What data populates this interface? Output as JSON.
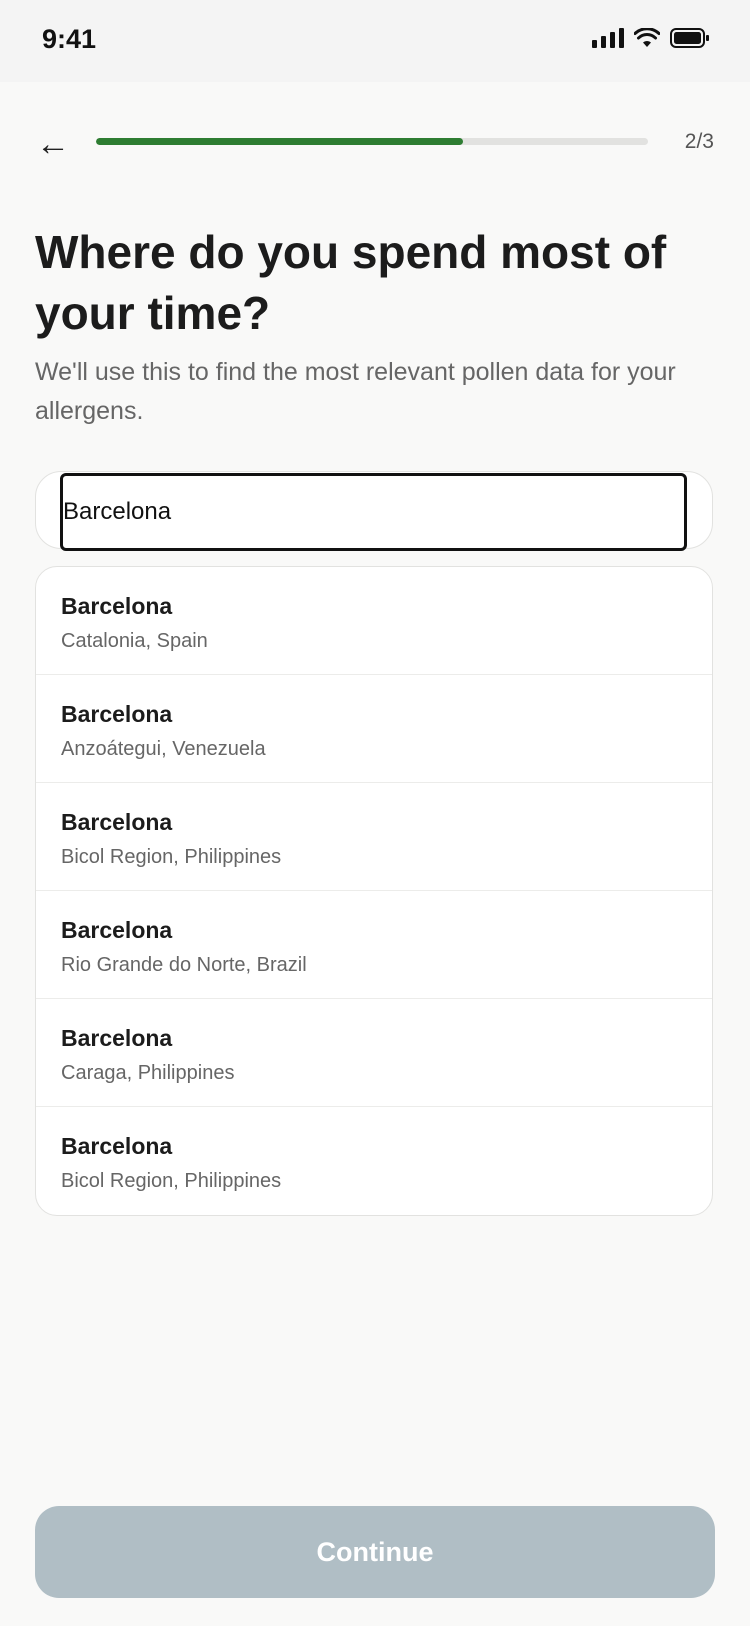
{
  "status_bar": {
    "time": "9:41"
  },
  "header": {
    "back_icon": "arrow-left-icon",
    "back_glyph": "←",
    "progress": 0.665,
    "progress_color": "#2e7d32",
    "step_counter": "2/3"
  },
  "main": {
    "title": "Where do you spend most of your time?",
    "subtitle": "We'll use this to find the most relevant pollen data for your allergens."
  },
  "search": {
    "value": "Barcelona",
    "placeholder": ""
  },
  "results": [
    {
      "name": "Barcelona",
      "region": "Catalonia, Spain"
    },
    {
      "name": "Barcelona",
      "region": "Anzoátegui, Venezuela"
    },
    {
      "name": "Barcelona",
      "region": "Bicol Region, Philippines"
    },
    {
      "name": "Barcelona",
      "region": "Rio Grande do Norte, Brazil"
    },
    {
      "name": "Barcelona",
      "region": "Caraga, Philippines"
    },
    {
      "name": "Barcelona",
      "region": "Bicol Region, Philippines"
    }
  ],
  "footer": {
    "continue_label": "Continue",
    "continue_color": "#b0bec5"
  }
}
